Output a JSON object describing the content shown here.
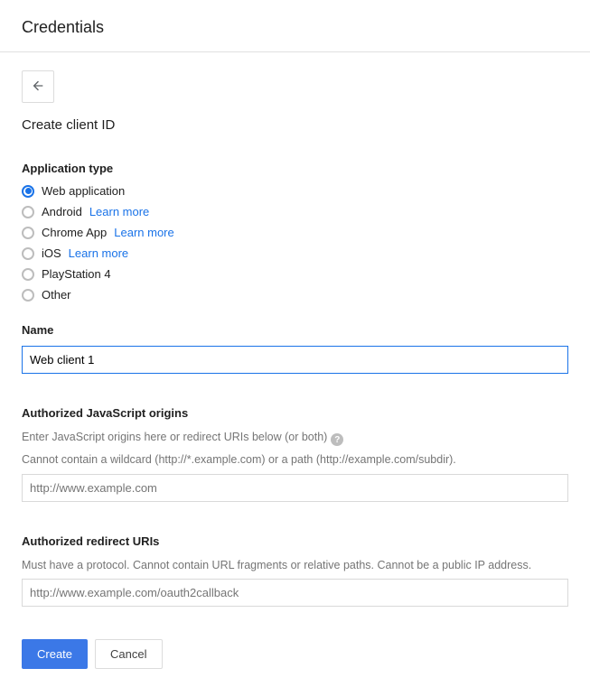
{
  "header": {
    "title": "Credentials"
  },
  "subtitle": "Create client ID",
  "app_type": {
    "label": "Application type",
    "options": [
      {
        "label": "Web application",
        "checked": true,
        "learn_more": ""
      },
      {
        "label": "Android",
        "checked": false,
        "learn_more": "Learn more"
      },
      {
        "label": "Chrome App",
        "checked": false,
        "learn_more": "Learn more"
      },
      {
        "label": "iOS",
        "checked": false,
        "learn_more": "Learn more"
      },
      {
        "label": "PlayStation 4",
        "checked": false,
        "learn_more": ""
      },
      {
        "label": "Other",
        "checked": false,
        "learn_more": ""
      }
    ]
  },
  "name": {
    "label": "Name",
    "value": "Web client 1"
  },
  "js_origins": {
    "label": "Authorized JavaScript origins",
    "help1": "Enter JavaScript origins here or redirect URIs below (or both)",
    "help2": "Cannot contain a wildcard (http://*.example.com) or a path (http://example.com/subdir).",
    "placeholder": "http://www.example.com"
  },
  "redirect_uris": {
    "label": "Authorized redirect URIs",
    "help1": "Must have a protocol. Cannot contain URL fragments or relative paths. Cannot be a public IP address.",
    "placeholder": "http://www.example.com/oauth2callback"
  },
  "actions": {
    "create": "Create",
    "cancel": "Cancel"
  }
}
